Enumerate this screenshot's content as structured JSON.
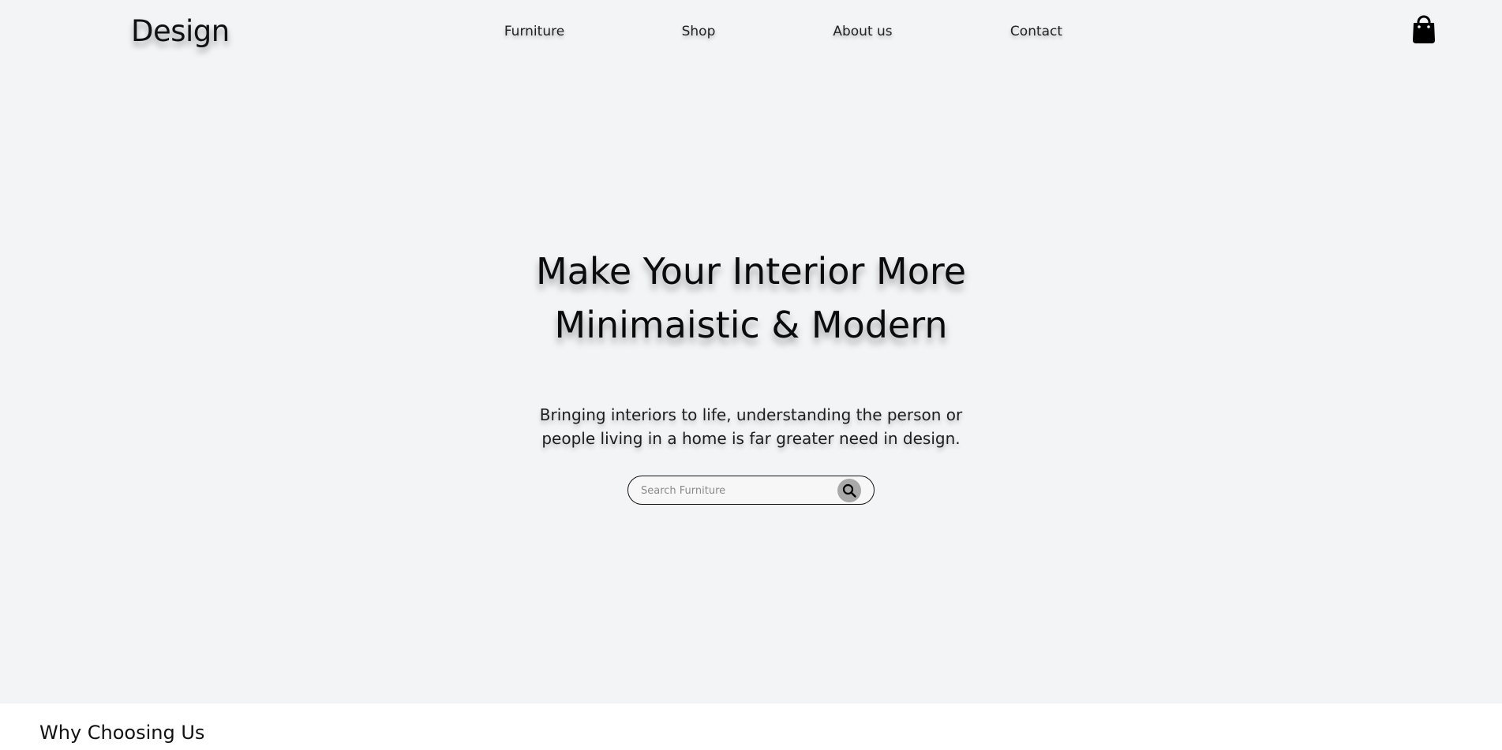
{
  "header": {
    "logo": "Design",
    "nav": [
      "Furniture",
      "Shop",
      "About us",
      "Contact"
    ],
    "cart_icon": "shopping-bag-icon"
  },
  "hero": {
    "title_line1": "Make Your Interior More",
    "title_line2": "Minimaistic & Modern",
    "subtitle_line1": "Bringing interiors to life, understanding the person or",
    "subtitle_line2": "people living in a home is far greater need in design."
  },
  "search": {
    "placeholder": "Search Furniture",
    "value": "",
    "icon": "search-icon"
  },
  "why": {
    "heading": "Why Choosing Us"
  },
  "colors": {
    "background": "#f3f4f6",
    "section_background": "#ffffff",
    "text": "#111111",
    "search_button": "#a9a9a9"
  }
}
